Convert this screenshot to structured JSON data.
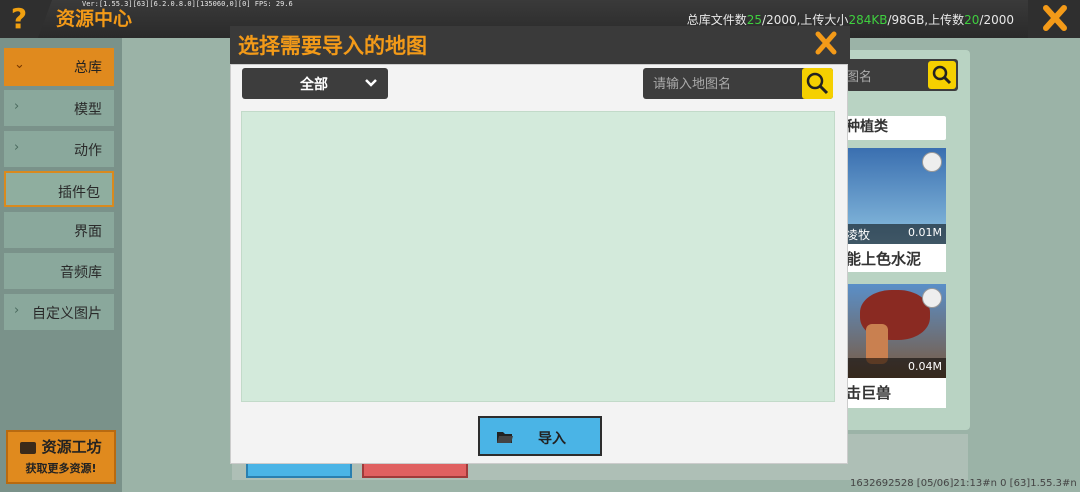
{
  "app": {
    "title": "资源中心",
    "version_line": "Ver:[1.55.3][63][6.2.0.8.0][135060,0][0] FPS: 29.6",
    "stats": {
      "prefix": "总库文件数",
      "count": "25",
      "count_max": "/2000,上传大小",
      "size": "284KB",
      "size_max": "/98GB,上传数",
      "uploads": "20",
      "uploads_max": "/2000"
    }
  },
  "sidebar": {
    "items": [
      {
        "label": "总库"
      },
      {
        "label": "模型"
      },
      {
        "label": "动作"
      },
      {
        "label": "插件包"
      },
      {
        "label": "界面"
      },
      {
        "label": "音频库"
      },
      {
        "label": "自定义图片"
      }
    ],
    "workshop": {
      "title": "资源工坊",
      "subtitle": "获取更多资源!"
    }
  },
  "background_cards": [
    {
      "title": "种植类"
    },
    {
      "author": "凌牧",
      "size": "0.01M",
      "name": "能上色水泥"
    },
    {
      "size": "0.04M",
      "name": "击巨兽"
    }
  ],
  "background_search_placeholder": "图名",
  "bottom_info": "1632692528   [05/06]21:13#n 0   [63]1.55.3#n",
  "modal": {
    "title": "选择需要导入的地图",
    "filter": {
      "selected": "全部"
    },
    "search": {
      "placeholder": "请输入地图名"
    },
    "import_label": "导入"
  },
  "colors": {
    "accent": "#f39a18",
    "header_bg": "#3a3a3a",
    "list_bg": "#d3eadb",
    "import_btn": "#4ab4e6",
    "search_btn": "#f5d000"
  }
}
